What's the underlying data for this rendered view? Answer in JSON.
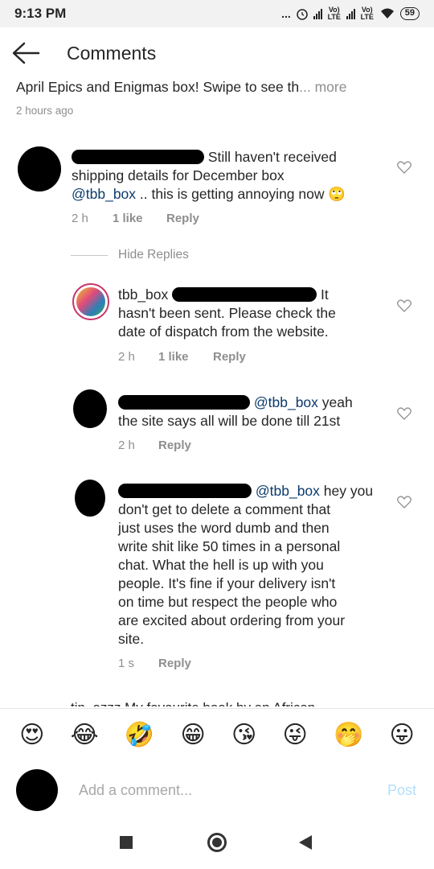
{
  "status_bar": {
    "time": "9:13 PM",
    "dots": "...",
    "network_1": "Vo) LTE",
    "network_2": "Vo) LTE",
    "battery": "59"
  },
  "header": {
    "title": "Comments",
    "back_icon": "arrow-left-icon"
  },
  "caption": {
    "text": "April Epics and Enigmas box! Swipe to see th",
    "more_label": "... more",
    "time": "2 hours ago"
  },
  "comments": [
    {
      "text_line1": "Still haven't received",
      "text_line2": "shipping details for December box",
      "mention": "@tbb_box",
      "text_line3": " .. this is getting annoying now ",
      "emoji": "🙄",
      "time": "2 h",
      "likes": "1 like",
      "reply_label": "Reply"
    }
  ],
  "hide_replies_label": "Hide Replies",
  "replies": [
    {
      "username": "tbb_box",
      "text_head": "It",
      "text_line2": "hasn't been sent. Please check the",
      "text_line3": "date of dispatch from the website.",
      "time": "2 h",
      "likes": "1 like",
      "reply_label": "Reply"
    },
    {
      "mention": "@tbb_box",
      "text_head": " yeah",
      "text_line2": "the site says all will be done till 21st",
      "time": "2 h",
      "reply_label": "Reply"
    },
    {
      "mention": "@tbb_box",
      "text_head": " hey you",
      "lines": [
        "don't get to delete a comment that",
        "just uses the word dumb and then",
        "write shit like 50 times in a personal",
        "chat. What the hell is up with you",
        "people. It's fine if your delivery isn't",
        "on time but respect the people who",
        "are excited about ordering from your",
        "site."
      ],
      "time": "1 s",
      "reply_label": "Reply"
    }
  ],
  "cut_off_text": "tin_ozzz My favourite book by an African",
  "emoji_bar": [
    "😍",
    "😂",
    "🤣",
    "😁",
    "😘",
    "😜",
    "🤭",
    "😛"
  ],
  "input": {
    "placeholder": "Add a comment...",
    "post_label": "Post"
  },
  "colors": {
    "mention": "#0c3b6d",
    "muted": "#8e8e8e",
    "post_disabled": "#b2dffc"
  }
}
